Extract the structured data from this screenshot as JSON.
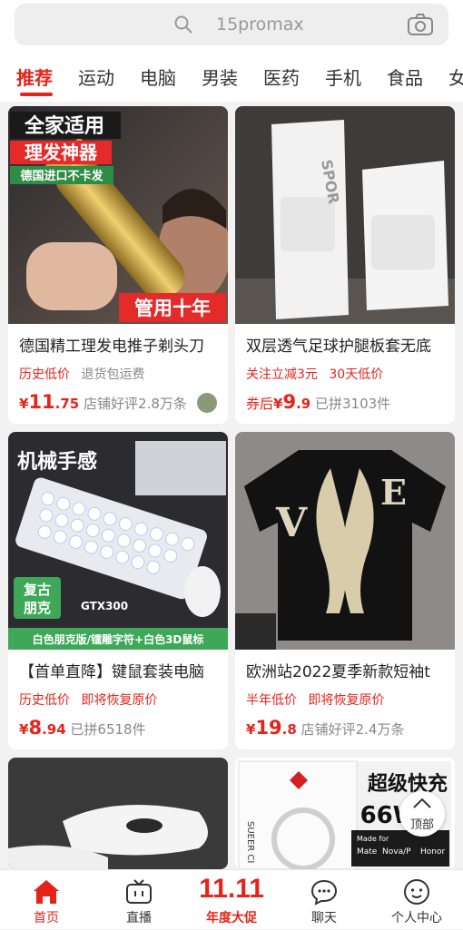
{
  "search": {
    "query": "15promax"
  },
  "tabs": [
    {
      "label": "推荐"
    },
    {
      "label": "运动"
    },
    {
      "label": "电脑"
    },
    {
      "label": "男装"
    },
    {
      "label": "医药"
    },
    {
      "label": "手机"
    },
    {
      "label": "食品"
    },
    {
      "label": "女"
    }
  ],
  "products": [
    {
      "img_text": [
        "全家适用",
        "理发神器",
        "德国进口不卡发",
        "管用十年"
      ],
      "title": "德国精工理发电推子剃头刀",
      "tag_red": "历史低价",
      "tag_grey": "退货包运费",
      "price_prefix": "",
      "currency": "¥",
      "price_int": "11",
      "price_dec": ".75",
      "meta": "店铺好评2.8万条"
    },
    {
      "img_text": [
        "SPOR"
      ],
      "title": "双层透气足球护腿板套无底",
      "tag_red": "关注立减3元",
      "tag_red2": "30天低价",
      "price_prefix": "券后",
      "currency": "¥",
      "price_int": "9",
      "price_dec": ".9",
      "meta": "已拼3103件"
    },
    {
      "img_text": [
        "机械手感",
        "复古",
        "朋克",
        "GTX300",
        "白色朋克版/镭雕字符+白色3D鼠标"
      ],
      "title": "【首单直降】键鼠套装电脑",
      "tag_red": "历史低价",
      "tag_red2": "即将恢复原价",
      "price_prefix": "",
      "currency": "¥",
      "price_int": "8",
      "price_dec": ".94",
      "meta": "已拼6518件"
    },
    {
      "img_text": [
        "V",
        "E"
      ],
      "title": "欧洲站2022夏季新款短袖t",
      "tag_red": "半年低价",
      "tag_red2": "即将恢复原价",
      "price_prefix": "",
      "currency": "¥",
      "price_int": "19",
      "price_dec": ".8",
      "meta": "店铺好评2.4万条"
    },
    {
      "img_text": []
    },
    {
      "img_text": [
        "超级快充",
        "66W",
        "SUEER CI",
        "Made for",
        "Mate",
        "Nova/P",
        "Honor"
      ]
    }
  ],
  "back_to_top": "顶部",
  "bottom_nav": [
    {
      "label": "首页",
      "icon": "home-icon"
    },
    {
      "label": "直播",
      "icon": "tv-icon"
    },
    {
      "label": "年度大促",
      "big": "11.11"
    },
    {
      "label": "聊天",
      "icon": "chat-icon"
    },
    {
      "label": "个人中心",
      "icon": "user-icon"
    }
  ],
  "colors": {
    "accent": "#e5231b"
  }
}
